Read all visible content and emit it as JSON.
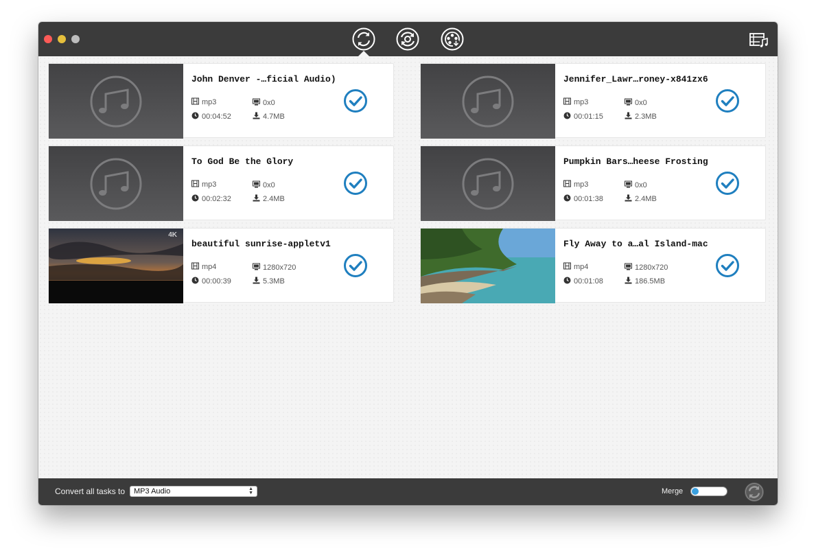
{
  "window": {
    "toolbar": {
      "tabs": [
        {
          "icon": "convert-icon",
          "active": true
        },
        {
          "icon": "rotate-settings-icon",
          "active": false
        },
        {
          "icon": "film-download-icon",
          "active": false
        }
      ],
      "right_icon": "video-music-icon"
    }
  },
  "tasks": [
    {
      "title": "John Denver -…ficial Audio)",
      "format": "mp3",
      "resolution": "0x0",
      "duration": "00:04:52",
      "size": "4.7MB",
      "thumbnail": "music-note"
    },
    {
      "title": "Jennifer_Lawr…roney-x841zx6",
      "format": "mp3",
      "resolution": "0x0",
      "duration": "00:01:15",
      "size": "2.3MB",
      "thumbnail": "music-note"
    },
    {
      "title": "To God Be the Glory",
      "format": "mp3",
      "resolution": "0x0",
      "duration": "00:02:32",
      "size": "2.4MB",
      "thumbnail": "music-note"
    },
    {
      "title": "Pumpkin Bars…heese Frosting",
      "format": "mp3",
      "resolution": "0x0",
      "duration": "00:01:38",
      "size": "2.4MB",
      "thumbnail": "music-note"
    },
    {
      "title": "beautiful sunrise-appletv1",
      "format": "mp4",
      "resolution": "1280x720",
      "duration": "00:00:39",
      "size": "5.3MB",
      "thumbnail": "sunrise",
      "badge": "4K"
    },
    {
      "title": "Fly Away to a…al Island-mac",
      "format": "mp4",
      "resolution": "1280x720",
      "duration": "00:01:08",
      "size": "186.5MB",
      "thumbnail": "beach"
    }
  ],
  "footer": {
    "convert_label": "Convert all tasks to",
    "format_selected": "MP3 Audio",
    "merge_label": "Merge",
    "merge_on": false
  },
  "colors": {
    "titlebar": "#3b3b3b",
    "accent": "#1f7fbf",
    "close": "#fc5b57",
    "minimize": "#e5bf3c",
    "maximize": "#bdbdbd"
  }
}
